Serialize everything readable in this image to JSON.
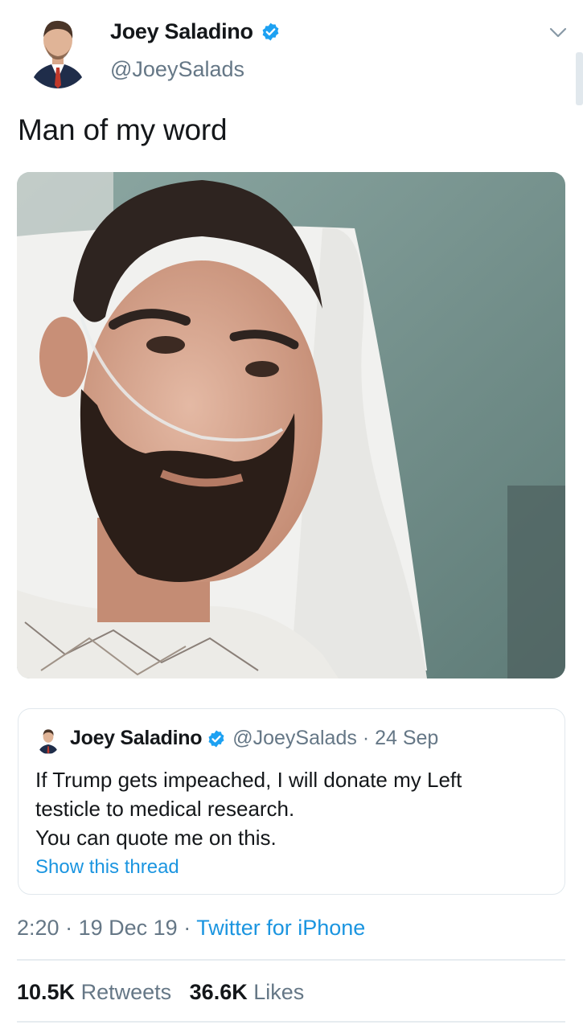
{
  "tweet": {
    "display_name": "Joey Saladino",
    "handle": "@JoeySalads",
    "text": "Man of my word",
    "verified_icon": "verified-badge-icon",
    "menu_icon": "chevron-down-icon"
  },
  "quoted_tweet": {
    "display_name": "Joey Saladino",
    "handle": "@JoeySalads",
    "separator": "·",
    "date": "24 Sep",
    "lines": [
      "If Trump gets impeached, I will donate my Left",
      "testicle to medical research.",
      "You can quote me on this."
    ],
    "show_thread": "Show this thread"
  },
  "timestamp": {
    "time": "2:20",
    "sep1": "·",
    "date": "19 Dec 19",
    "sep2": "·",
    "source": "Twitter for iPhone"
  },
  "stats": {
    "retweets_count": "10.5K",
    "retweets_label": "Retweets",
    "likes_count": "36.6K",
    "likes_label": "Likes"
  },
  "colors": {
    "link_blue": "#1b95e0",
    "verified_blue": "#1da1f2",
    "secondary_text": "#657786",
    "divider": "#e6ecf0"
  }
}
